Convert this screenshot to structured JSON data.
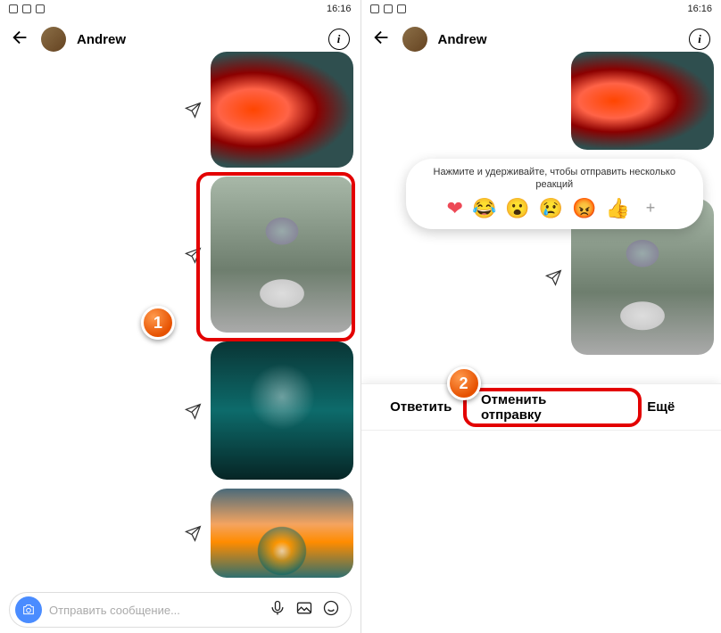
{
  "statusbar": {
    "time": "16:16"
  },
  "header": {
    "username": "Andrew"
  },
  "composer": {
    "placeholder": "Отправить сообщение..."
  },
  "reactions": {
    "hint": "Нажмите  и удерживайте, чтобы отправить несколько реакций",
    "emojis": [
      "❤",
      "😂",
      "😮",
      "😢",
      "😡",
      "👍"
    ]
  },
  "action_sheet": {
    "reply": "Ответить",
    "unsend": "Отменить отправку",
    "more": "Ещё"
  },
  "tutorial": {
    "step1": "1",
    "step2": "2"
  },
  "info_glyph": "i"
}
